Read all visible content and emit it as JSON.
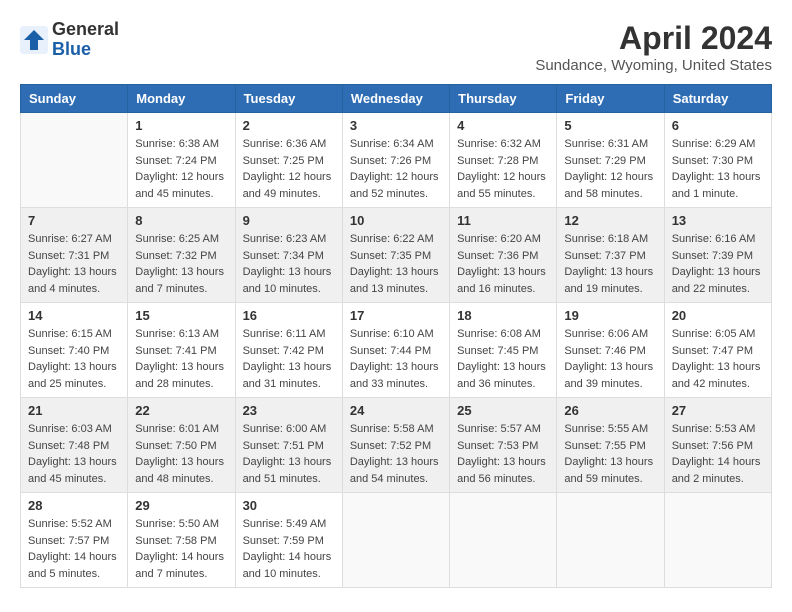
{
  "logo": {
    "general": "General",
    "blue": "Blue"
  },
  "title": "April 2024",
  "subtitle": "Sundance, Wyoming, United States",
  "days_of_week": [
    "Sunday",
    "Monday",
    "Tuesday",
    "Wednesday",
    "Thursday",
    "Friday",
    "Saturday"
  ],
  "weeks": [
    [
      {
        "day": "",
        "info": ""
      },
      {
        "day": "1",
        "info": "Sunrise: 6:38 AM\nSunset: 7:24 PM\nDaylight: 12 hours\nand 45 minutes."
      },
      {
        "day": "2",
        "info": "Sunrise: 6:36 AM\nSunset: 7:25 PM\nDaylight: 12 hours\nand 49 minutes."
      },
      {
        "day": "3",
        "info": "Sunrise: 6:34 AM\nSunset: 7:26 PM\nDaylight: 12 hours\nand 52 minutes."
      },
      {
        "day": "4",
        "info": "Sunrise: 6:32 AM\nSunset: 7:28 PM\nDaylight: 12 hours\nand 55 minutes."
      },
      {
        "day": "5",
        "info": "Sunrise: 6:31 AM\nSunset: 7:29 PM\nDaylight: 12 hours\nand 58 minutes."
      },
      {
        "day": "6",
        "info": "Sunrise: 6:29 AM\nSunset: 7:30 PM\nDaylight: 13 hours\nand 1 minute."
      }
    ],
    [
      {
        "day": "7",
        "info": "Sunrise: 6:27 AM\nSunset: 7:31 PM\nDaylight: 13 hours\nand 4 minutes."
      },
      {
        "day": "8",
        "info": "Sunrise: 6:25 AM\nSunset: 7:32 PM\nDaylight: 13 hours\nand 7 minutes."
      },
      {
        "day": "9",
        "info": "Sunrise: 6:23 AM\nSunset: 7:34 PM\nDaylight: 13 hours\nand 10 minutes."
      },
      {
        "day": "10",
        "info": "Sunrise: 6:22 AM\nSunset: 7:35 PM\nDaylight: 13 hours\nand 13 minutes."
      },
      {
        "day": "11",
        "info": "Sunrise: 6:20 AM\nSunset: 7:36 PM\nDaylight: 13 hours\nand 16 minutes."
      },
      {
        "day": "12",
        "info": "Sunrise: 6:18 AM\nSunset: 7:37 PM\nDaylight: 13 hours\nand 19 minutes."
      },
      {
        "day": "13",
        "info": "Sunrise: 6:16 AM\nSunset: 7:39 PM\nDaylight: 13 hours\nand 22 minutes."
      }
    ],
    [
      {
        "day": "14",
        "info": "Sunrise: 6:15 AM\nSunset: 7:40 PM\nDaylight: 13 hours\nand 25 minutes."
      },
      {
        "day": "15",
        "info": "Sunrise: 6:13 AM\nSunset: 7:41 PM\nDaylight: 13 hours\nand 28 minutes."
      },
      {
        "day": "16",
        "info": "Sunrise: 6:11 AM\nSunset: 7:42 PM\nDaylight: 13 hours\nand 31 minutes."
      },
      {
        "day": "17",
        "info": "Sunrise: 6:10 AM\nSunset: 7:44 PM\nDaylight: 13 hours\nand 33 minutes."
      },
      {
        "day": "18",
        "info": "Sunrise: 6:08 AM\nSunset: 7:45 PM\nDaylight: 13 hours\nand 36 minutes."
      },
      {
        "day": "19",
        "info": "Sunrise: 6:06 AM\nSunset: 7:46 PM\nDaylight: 13 hours\nand 39 minutes."
      },
      {
        "day": "20",
        "info": "Sunrise: 6:05 AM\nSunset: 7:47 PM\nDaylight: 13 hours\nand 42 minutes."
      }
    ],
    [
      {
        "day": "21",
        "info": "Sunrise: 6:03 AM\nSunset: 7:48 PM\nDaylight: 13 hours\nand 45 minutes."
      },
      {
        "day": "22",
        "info": "Sunrise: 6:01 AM\nSunset: 7:50 PM\nDaylight: 13 hours\nand 48 minutes."
      },
      {
        "day": "23",
        "info": "Sunrise: 6:00 AM\nSunset: 7:51 PM\nDaylight: 13 hours\nand 51 minutes."
      },
      {
        "day": "24",
        "info": "Sunrise: 5:58 AM\nSunset: 7:52 PM\nDaylight: 13 hours\nand 54 minutes."
      },
      {
        "day": "25",
        "info": "Sunrise: 5:57 AM\nSunset: 7:53 PM\nDaylight: 13 hours\nand 56 minutes."
      },
      {
        "day": "26",
        "info": "Sunrise: 5:55 AM\nSunset: 7:55 PM\nDaylight: 13 hours\nand 59 minutes."
      },
      {
        "day": "27",
        "info": "Sunrise: 5:53 AM\nSunset: 7:56 PM\nDaylight: 14 hours\nand 2 minutes."
      }
    ],
    [
      {
        "day": "28",
        "info": "Sunrise: 5:52 AM\nSunset: 7:57 PM\nDaylight: 14 hours\nand 5 minutes."
      },
      {
        "day": "29",
        "info": "Sunrise: 5:50 AM\nSunset: 7:58 PM\nDaylight: 14 hours\nand 7 minutes."
      },
      {
        "day": "30",
        "info": "Sunrise: 5:49 AM\nSunset: 7:59 PM\nDaylight: 14 hours\nand 10 minutes."
      },
      {
        "day": "",
        "info": ""
      },
      {
        "day": "",
        "info": ""
      },
      {
        "day": "",
        "info": ""
      },
      {
        "day": "",
        "info": ""
      }
    ]
  ]
}
